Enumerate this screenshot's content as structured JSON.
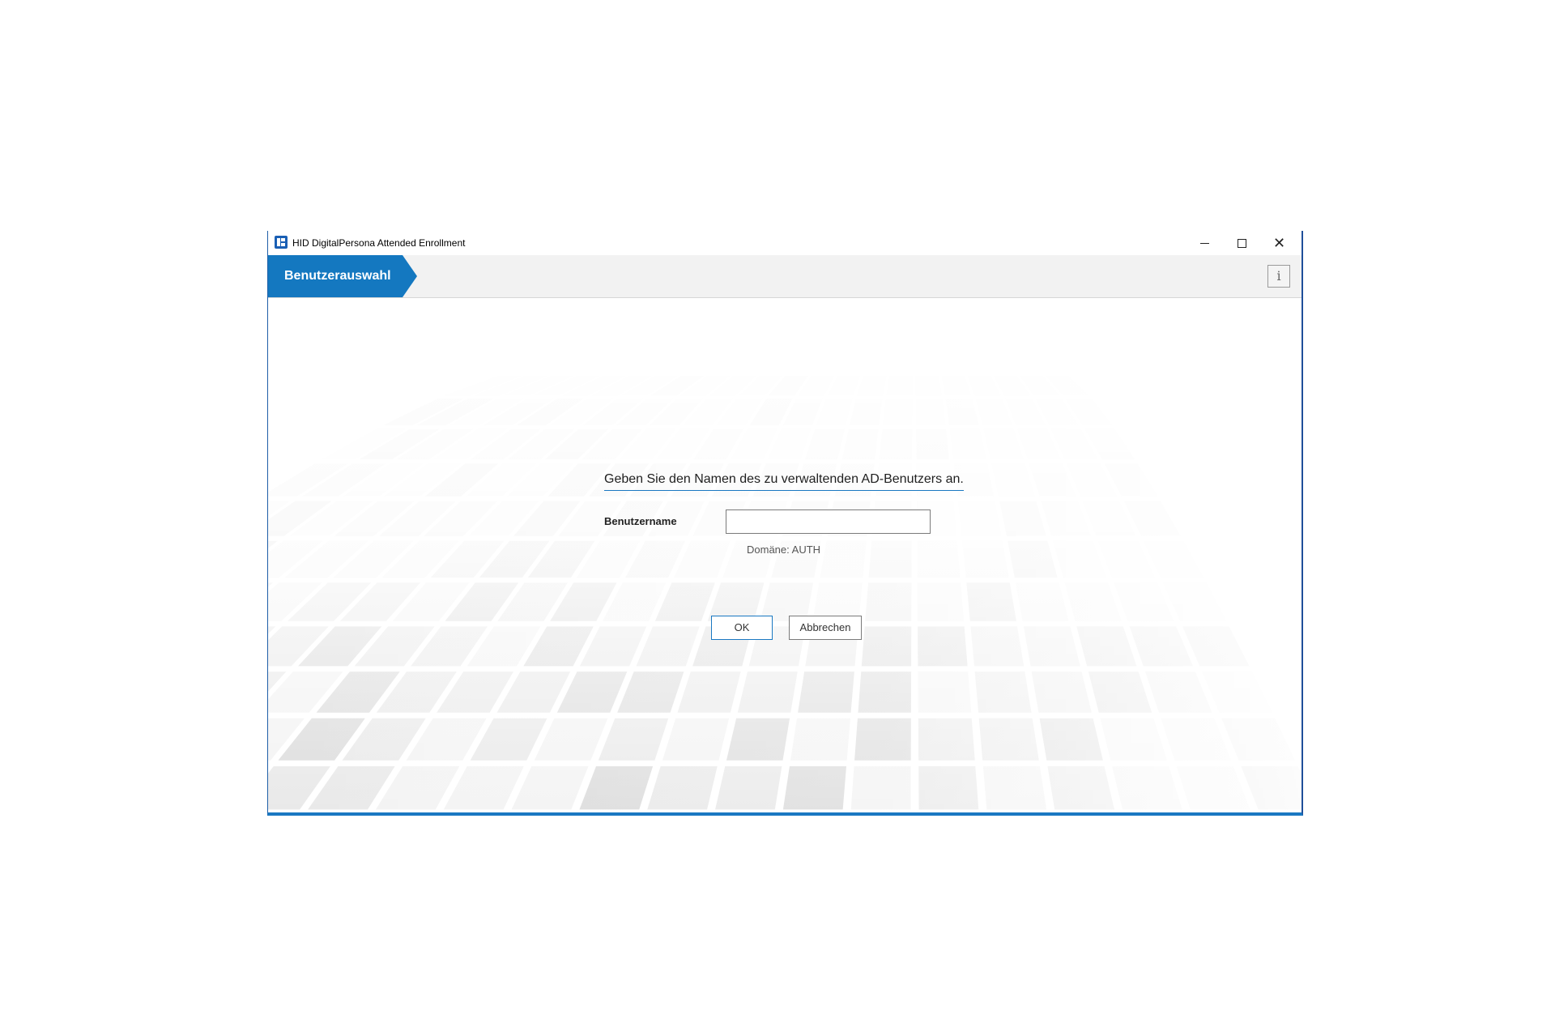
{
  "window": {
    "title": "HID DigitalPersona Attended Enrollment",
    "controls": {
      "minimize": "minimize",
      "maximize": "maximize",
      "close": "close"
    }
  },
  "header": {
    "step_label": "Benutzerauswahl",
    "info_label": "i"
  },
  "form": {
    "prompt": "Geben Sie den Namen des zu verwaltenden AD-Benutzers an.",
    "username_label": "Benutzername",
    "username_value": "",
    "domain_text": "Domäne: AUTH"
  },
  "buttons": {
    "ok_label": "OK",
    "cancel_label": "Abbrechen"
  },
  "colors": {
    "accent": "#1a78c2",
    "step_tab": "#1478c0",
    "header_band": "#f2f2f2",
    "window_border": "#1f4f9a"
  },
  "icons": {
    "app": "hid-app-icon",
    "minimize": "minimize-icon",
    "maximize": "maximize-icon",
    "close": "close-icon",
    "info": "info-icon"
  }
}
